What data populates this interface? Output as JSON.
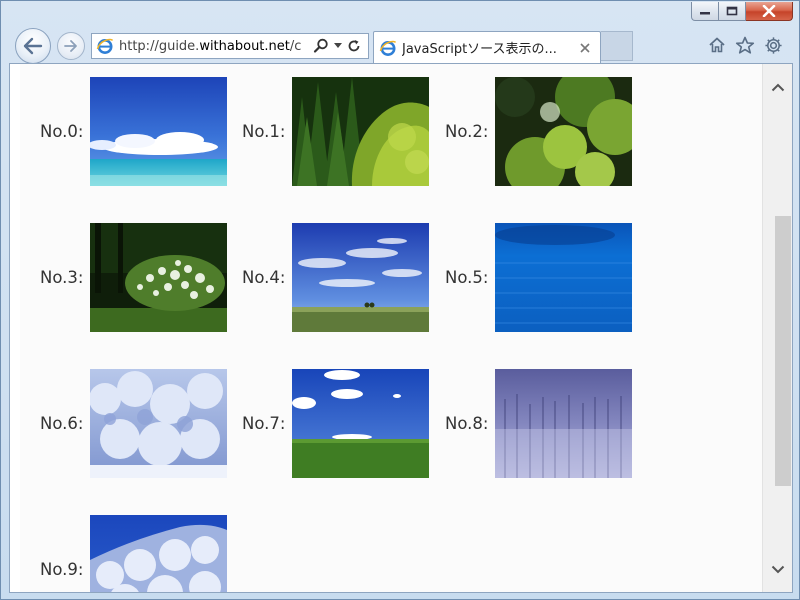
{
  "browser": {
    "address_url_prefix": "http://guide.",
    "address_url_domain": "withabout.net",
    "address_url_rest": "/c",
    "tab_title": "JavaScriptソース表示の..."
  },
  "gallery": {
    "items": [
      {
        "label": "No.0:",
        "scene": "sky-ocean"
      },
      {
        "label": "No.1:",
        "scene": "green-forest"
      },
      {
        "label": "No.2:",
        "scene": "tree-canopy"
      },
      {
        "label": "No.3:",
        "scene": "flowering-shrub"
      },
      {
        "label": "No.4:",
        "scene": "field-clouds"
      },
      {
        "label": "No.5:",
        "scene": "blue-water"
      },
      {
        "label": "No.6:",
        "scene": "snowy-trees"
      },
      {
        "label": "No.7:",
        "scene": "green-hill"
      },
      {
        "label": "No.8:",
        "scene": "winter-forest"
      },
      {
        "label": "No.9:",
        "scene": "snowy-hill"
      }
    ]
  },
  "colors": {
    "close_button": "#d14f35",
    "tab_background": "#ffffff",
    "page_background": "#fbfbfb"
  }
}
